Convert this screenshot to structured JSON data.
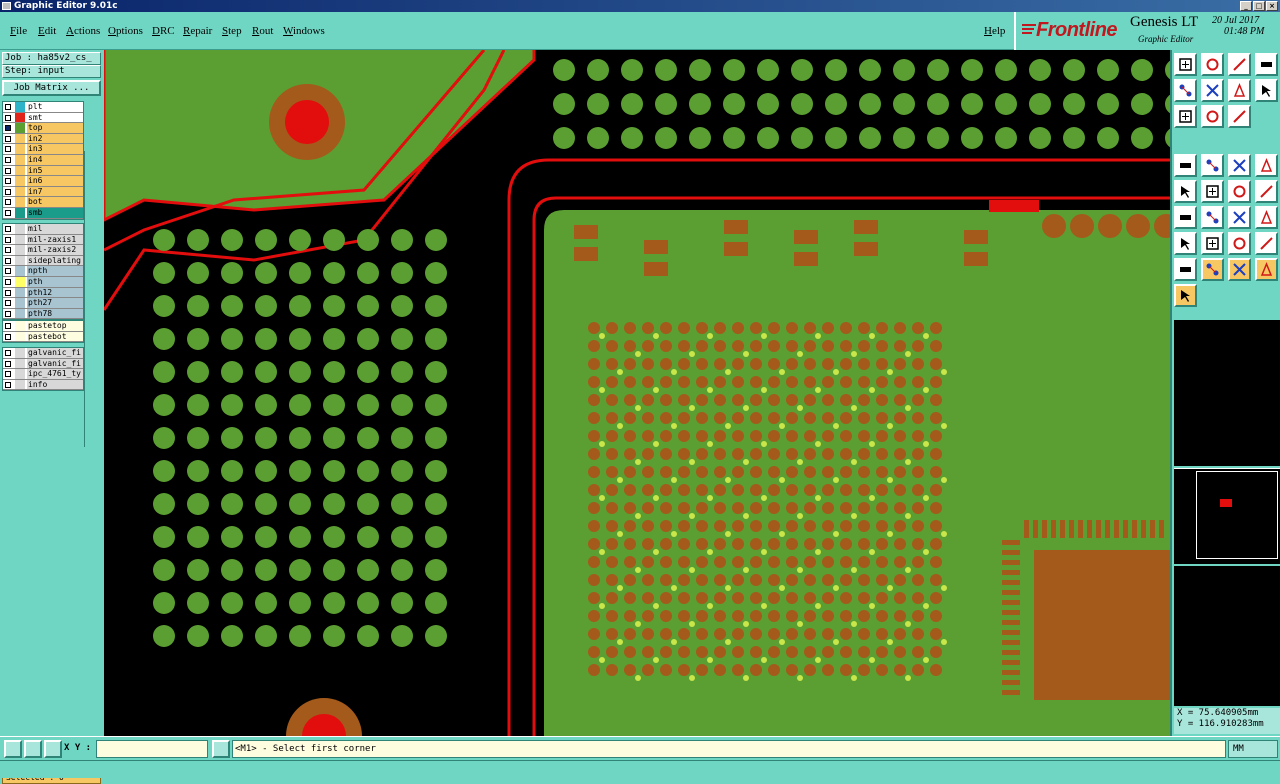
{
  "window": {
    "title": "Graphic Editor 9.01c"
  },
  "menu": [
    "File",
    "Edit",
    "Actions",
    "Options",
    "DRC",
    "Repair",
    "Step",
    "Rout",
    "Windows"
  ],
  "help_label": "Help",
  "brand": {
    "logo": "Frontline",
    "product": "Genesis LT",
    "subtitle": "Graphic Editor",
    "date": "20 Jul 2017",
    "time": "01:48 PM"
  },
  "job": {
    "job_label": "Job : ha85v2_cs_",
    "step_label": "Step: input",
    "matrix_button": "Job Matrix ..."
  },
  "layer_groups": [
    [
      {
        "name": "plt",
        "color": "#2db3c9"
      },
      {
        "name": "smt",
        "color": "#e2231a"
      },
      {
        "name": "top",
        "color": "#5b9e32",
        "active": true,
        "bg": "#f6c763"
      },
      {
        "name": "in2",
        "color": "#f6c763",
        "bg": "#f6c763"
      },
      {
        "name": "in3",
        "color": "#f6c763",
        "bg": "#f6c763"
      },
      {
        "name": "in4",
        "color": "#f6c763",
        "bg": "#f6c763"
      },
      {
        "name": "in5",
        "color": "#f6c763",
        "bg": "#f6c763"
      },
      {
        "name": "in6",
        "color": "#f6c763",
        "bg": "#f6c763"
      },
      {
        "name": "in7",
        "color": "#f6c763",
        "bg": "#f6c763"
      },
      {
        "name": "bot",
        "color": "#f6c763",
        "bg": "#f6c763"
      },
      {
        "name": "smb",
        "color": "#1b9b8a",
        "bg": "#1b9b8a"
      }
    ],
    [
      {
        "name": "mil",
        "color": "#d8d8d8",
        "bg": "#d8d8d8"
      },
      {
        "name": "mil-zaxis1",
        "color": "#d8d8d8",
        "bg": "#d8d8d8"
      },
      {
        "name": "mil-zaxis2",
        "color": "#d8d8d8",
        "bg": "#d8d8d8"
      },
      {
        "name": "sideplating",
        "color": "#d8d8d8",
        "bg": "#d8d8d8"
      },
      {
        "name": "npth",
        "color": "#a8c4d0",
        "bg": "#a8c4d0"
      },
      {
        "name": "pth",
        "color": "#ffff66",
        "bg": "#a8c4d0"
      },
      {
        "name": "pth12",
        "color": "#a8c4d0",
        "bg": "#a8c4d0"
      },
      {
        "name": "pth27",
        "color": "#a8c4d0",
        "bg": "#a8c4d0"
      },
      {
        "name": "pth78",
        "color": "#a8c4d0",
        "bg": "#a8c4d0"
      }
    ],
    [
      {
        "name": "pastetop",
        "color": "#fffde0",
        "bg": "#fffde0"
      },
      {
        "name": "pastebot",
        "color": "#fffde0",
        "bg": "#fffde0"
      }
    ],
    [
      {
        "name": "galvanic_fi",
        "color": "#d8d8d8",
        "bg": "#d8d8d8"
      },
      {
        "name": "galvanic_fi",
        "color": "#d8d8d8",
        "bg": "#d8d8d8"
      },
      {
        "name": "ipc_4761_ty",
        "color": "#d8d8d8",
        "bg": "#d8d8d8"
      },
      {
        "name": "info",
        "color": "#d8d8d8",
        "bg": "#d8d8d8"
      }
    ]
  ],
  "selected_label": "Selected : 0",
  "coords": {
    "x": "X = 75.640905mm",
    "y": "Y = 116.910283mm"
  },
  "status": {
    "xy_label": "X Y :",
    "xy_value": "",
    "message": "<M1> - Select first corner",
    "units": "MM"
  },
  "colors": {
    "copper": "#5b9e32",
    "pad": "#a45a1a",
    "via_hole": "#c9e64a",
    "outline": "#e20d0d",
    "background": "#000000",
    "panel": "#6fd6c4"
  },
  "tool_icons": [
    "zoom-in-icon",
    "zoom-out-icon",
    "home-icon",
    "pan-left-icon",
    "pan-right-icon",
    "redraw-icon",
    "fit-icon",
    "zoom-1-icon",
    "query-icon",
    "measure-icon",
    "grid-icon",
    "snap-icon",
    "shape-icon",
    "line-icon",
    "pad-icon",
    "connect-icon",
    "cross-icon",
    "move-icon",
    "add-icon",
    "add-line-icon",
    "add-arc-icon",
    "rotate-icon",
    "text-icon",
    "nets-icon",
    "sel-icon",
    "tri-icon",
    "tri2-icon",
    "tri3-icon",
    "arrow-icon",
    "arrow-sel-icon",
    "hand-icon",
    "multi-icon"
  ]
}
